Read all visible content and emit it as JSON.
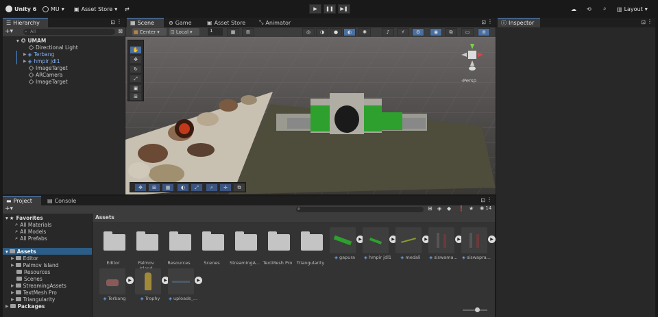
{
  "topbar": {
    "app": "Unity 6",
    "account": "MU",
    "asset_store": "Asset Store",
    "layout": "Layout"
  },
  "hierarchy": {
    "tab": "Hierarchy",
    "search_placeholder": "All",
    "scene": "UMAM",
    "items": [
      {
        "label": "Directional Light"
      },
      {
        "label": "Terbang"
      },
      {
        "label": "hmpir jdl1"
      },
      {
        "label": "ImageTarget"
      },
      {
        "label": "ARCamera"
      },
      {
        "label": "ImageTarget"
      }
    ]
  },
  "scene_view": {
    "tabs": [
      "Scene",
      "Game",
      "Asset Store",
      "Animator"
    ],
    "pivot": "Center",
    "space": "Local",
    "grid_snap": "1",
    "persp": "‹Persp"
  },
  "inspector": {
    "tab": "Inspector"
  },
  "project": {
    "tabs": [
      "Project",
      "Console"
    ],
    "favorites": "Favorites",
    "fav_items": [
      "All Materials",
      "All Models",
      "All Prefabs"
    ],
    "assets": "Assets",
    "asset_folders": [
      "Editor",
      "Palmov Island",
      "Resources",
      "Scenes",
      "StreamingAssets",
      "TextMesh Pro",
      "Triangularity"
    ],
    "packages": "Packages",
    "breadcrumb": "Assets",
    "hidden_count": "14",
    "grid_folders": [
      "Editor",
      "Palmov Island",
      "Resources",
      "Scenes",
      "StreamingA...",
      "TextMesh Pro",
      "Triangularity"
    ],
    "grid_assets": [
      "gapura",
      "hmpir jdl1",
      "medali",
      "siswama...",
      "siswapra...",
      "Terbang",
      "Trophy",
      "uploads_..."
    ]
  }
}
